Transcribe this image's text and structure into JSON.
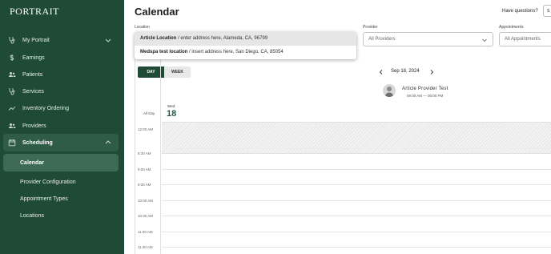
{
  "sidebar": {
    "logo": "PORTRAIT",
    "items": [
      {
        "label": "My Portrait",
        "icon": "stethoscope-icon"
      },
      {
        "label": "Earnings",
        "icon": "dollar-icon"
      },
      {
        "label": "Patients",
        "icon": "users-icon"
      },
      {
        "label": "Services",
        "icon": "stethoscope-icon"
      },
      {
        "label": "Inventory Ordering",
        "icon": "trend-icon"
      },
      {
        "label": "Providers",
        "icon": "users-icon"
      },
      {
        "label": "Scheduling",
        "icon": "calendar-icon"
      }
    ],
    "sub_items": [
      {
        "label": "Calendar"
      },
      {
        "label": "Provider Configuration"
      },
      {
        "label": "Appointment Types"
      },
      {
        "label": "Locations"
      }
    ]
  },
  "header": {
    "title": "Calendar",
    "help": "Have questions?",
    "button_fragment": "S"
  },
  "filters": {
    "location_label": "Location",
    "provider_label": "Provider",
    "provider_value": "All Providers",
    "appointments_label": "Appointments",
    "appointments_value": "All Appointments"
  },
  "location_options": [
    {
      "name": "Article Location",
      "address": " / enter address here, Alameda, CA, 96799"
    },
    {
      "name": "Medspa test location",
      "address": " / insert address here, San Diego, CA, 85054"
    }
  ],
  "calendar": {
    "view_day": "DAY",
    "view_week": "WEEK",
    "date": "Sep 18, 2024",
    "provider_name": "Article  Provider Test",
    "provider_hours": "09:00 AM — 05:00 PM",
    "all_day": "All Day",
    "dow": "Wed",
    "day_num": "18",
    "times": [
      "12:00 AM",
      "8:30 AM",
      "9:00 AM",
      "9:30 AM",
      "10:00 AM",
      "10:30 AM",
      "11:00 AM",
      "11:30 AM"
    ]
  }
}
